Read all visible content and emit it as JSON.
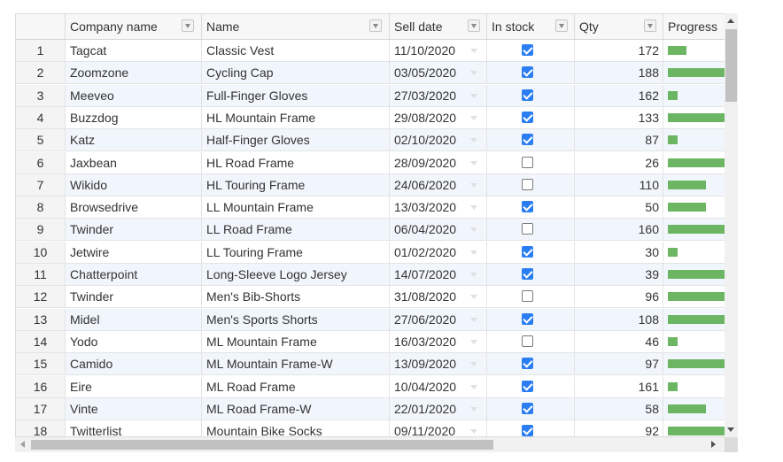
{
  "columns": [
    {
      "key": "rownum",
      "label": ""
    },
    {
      "key": "company",
      "label": "Company name"
    },
    {
      "key": "name",
      "label": "Name"
    },
    {
      "key": "sell_date",
      "label": "Sell date"
    },
    {
      "key": "in_stock",
      "label": "In stock"
    },
    {
      "key": "qty",
      "label": "Qty"
    },
    {
      "key": "progress",
      "label": "Progress"
    }
  ],
  "colors": {
    "progress_bar": "#6bb563",
    "checkbox_checked": "#2b7ef2",
    "alt_row": "#f1f5fc"
  },
  "rows": [
    {
      "n": "1",
      "company": "Tagcat",
      "name": "Classic Vest",
      "date": "11/10/2020",
      "in_stock": true,
      "qty": "172",
      "progress": 0.33
    },
    {
      "n": "2",
      "company": "Zoomzone",
      "name": "Cycling Cap",
      "date": "03/05/2020",
      "in_stock": true,
      "qty": "188",
      "progress": 1.0
    },
    {
      "n": "3",
      "company": "Meeveo",
      "name": "Full-Finger Gloves",
      "date": "27/03/2020",
      "in_stock": true,
      "qty": "162",
      "progress": 0.17
    },
    {
      "n": "4",
      "company": "Buzzdog",
      "name": "HL Mountain Frame",
      "date": "29/08/2020",
      "in_stock": true,
      "qty": "133",
      "progress": 1.0
    },
    {
      "n": "5",
      "company": "Katz",
      "name": "Half-Finger Gloves",
      "date": "02/10/2020",
      "in_stock": true,
      "qty": "87",
      "progress": 0.17
    },
    {
      "n": "6",
      "company": "Jaxbean",
      "name": "HL Road Frame",
      "date": "28/09/2020",
      "in_stock": false,
      "qty": "26",
      "progress": 1.0
    },
    {
      "n": "7",
      "company": "Wikido",
      "name": "HL Touring Frame",
      "date": "24/06/2020",
      "in_stock": false,
      "qty": "110",
      "progress": 0.67
    },
    {
      "n": "8",
      "company": "Browsedrive",
      "name": "LL Mountain Frame",
      "date": "13/03/2020",
      "in_stock": true,
      "qty": "50",
      "progress": 0.67
    },
    {
      "n": "9",
      "company": "Twinder",
      "name": "LL Road Frame",
      "date": "06/04/2020",
      "in_stock": false,
      "qty": "160",
      "progress": 1.0
    },
    {
      "n": "10",
      "company": "Jetwire",
      "name": "LL Touring Frame",
      "date": "01/02/2020",
      "in_stock": true,
      "qty": "30",
      "progress": 0.17
    },
    {
      "n": "11",
      "company": "Chatterpoint",
      "name": "Long-Sleeve Logo Jersey",
      "date": "14/07/2020",
      "in_stock": true,
      "qty": "39",
      "progress": 1.0
    },
    {
      "n": "12",
      "company": "Twinder",
      "name": "Men's Bib-Shorts",
      "date": "31/08/2020",
      "in_stock": false,
      "qty": "96",
      "progress": 1.0
    },
    {
      "n": "13",
      "company": "Midel",
      "name": "Men's Sports Shorts",
      "date": "27/06/2020",
      "in_stock": true,
      "qty": "108",
      "progress": 1.0
    },
    {
      "n": "14",
      "company": "Yodo",
      "name": "ML Mountain Frame",
      "date": "16/03/2020",
      "in_stock": false,
      "qty": "46",
      "progress": 0.17
    },
    {
      "n": "15",
      "company": "Camido",
      "name": "ML Mountain Frame-W",
      "date": "13/09/2020",
      "in_stock": true,
      "qty": "97",
      "progress": 1.0
    },
    {
      "n": "16",
      "company": "Eire",
      "name": "ML Road Frame",
      "date": "10/04/2020",
      "in_stock": true,
      "qty": "161",
      "progress": 0.17
    },
    {
      "n": "17",
      "company": "Vinte",
      "name": "ML Road Frame-W",
      "date": "22/01/2020",
      "in_stock": true,
      "qty": "58",
      "progress": 0.67
    },
    {
      "n": "18",
      "company": "Twitterlist",
      "name": "Mountain Bike Socks",
      "date": "09/11/2020",
      "in_stock": true,
      "qty": "92",
      "progress": 1.0
    }
  ]
}
